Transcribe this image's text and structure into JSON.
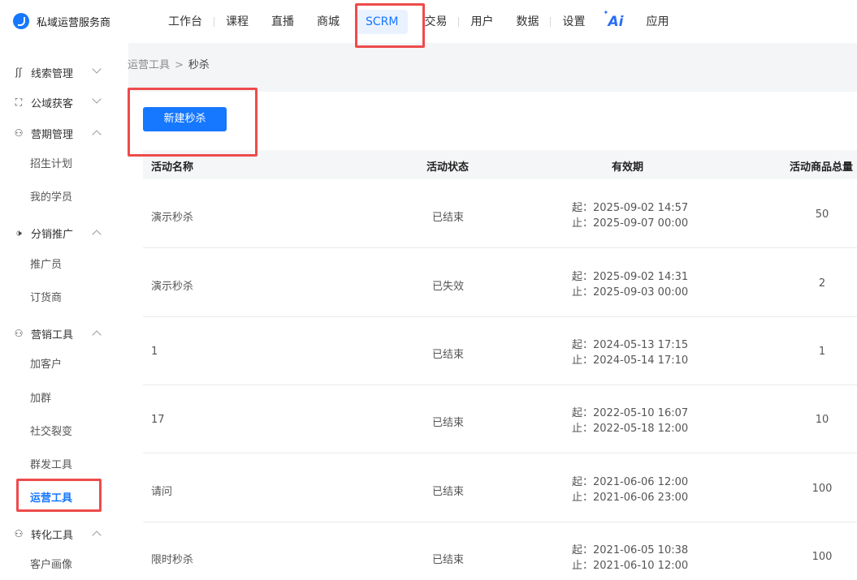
{
  "brand": {
    "name": "私域运营服务商"
  },
  "nav": {
    "items": [
      "工作台",
      "课程",
      "直播",
      "商城",
      "SCRM",
      "交易",
      "用户",
      "数据",
      "设置",
      "Ai",
      "应用"
    ],
    "active": "SCRM"
  },
  "sidebar": {
    "groups": [
      {
        "label": "线索管理",
        "icon": "clue-icon",
        "expanded": false,
        "items": []
      },
      {
        "label": "公域获客",
        "icon": "scan-face-icon",
        "expanded": false,
        "items": []
      },
      {
        "label": "营期管理",
        "icon": "user-manage-icon",
        "expanded": true,
        "items": [
          "招生计划",
          "我的学员"
        ]
      },
      {
        "label": "分销推广",
        "icon": "speaker-icon",
        "expanded": true,
        "items": [
          "推广员",
          "订货商"
        ]
      },
      {
        "label": "营销工具",
        "icon": "user-icon",
        "expanded": true,
        "items": [
          "加客户",
          "加群",
          "社交裂变",
          "群发工具",
          "运营工具"
        ]
      },
      {
        "label": "转化工具",
        "icon": "user-icon",
        "expanded": true,
        "items": [
          "客户画像"
        ]
      }
    ],
    "active_item": "运营工具"
  },
  "breadcrumb": {
    "parent": "运营工具",
    "separator": ">",
    "current": "秒杀"
  },
  "toolbar": {
    "new_label": "新建秒杀"
  },
  "table": {
    "headers": [
      "活动名称",
      "活动状态",
      "有效期",
      "活动商品总量"
    ],
    "rows": [
      {
        "name": "演示秒杀",
        "status": "已结束",
        "start": "起：2025-09-02 14:57",
        "end": "止：2025-09-07 00:00",
        "qty": "50"
      },
      {
        "name": "演示秒杀",
        "status": "已失效",
        "start": "起：2025-09-02 14:31",
        "end": "止：2025-09-03 00:00",
        "qty": "2"
      },
      {
        "name": "1",
        "status": "已结束",
        "start": "起：2024-05-13 17:15",
        "end": "止：2024-05-14 17:10",
        "qty": "1"
      },
      {
        "name": "17",
        "status": "已结束",
        "start": "起：2022-05-10 16:07",
        "end": "止：2022-05-18 12:00",
        "qty": "10"
      },
      {
        "name": "请问",
        "status": "已结束",
        "start": "起：2021-06-06 12:00",
        "end": "止：2021-06-06 23:00",
        "qty": "100"
      },
      {
        "name": "限时秒杀",
        "status": "已结束",
        "start": "起：2021-06-05 10:38",
        "end": "止：2021-06-10 12:00",
        "qty": "100"
      }
    ]
  },
  "colors": {
    "accent": "#1677ff",
    "highlight": "#ee4b4b"
  }
}
